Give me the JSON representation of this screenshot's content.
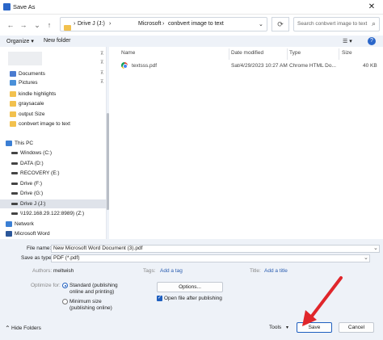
{
  "window": {
    "title": "Save As",
    "close": "✕"
  },
  "nav": {
    "back": "←",
    "forward": "→",
    "up": "↑"
  },
  "address": {
    "segments": [
      "›",
      "Drive J (J:)",
      "›",
      "Microsoft",
      "›",
      "conbvert image to text"
    ],
    "dropdown": "⌄"
  },
  "refresh": "⟳",
  "search": {
    "placeholder": "Search conbvert image to text",
    "icon": "⌕"
  },
  "toolbar": {
    "organize": "Organize ▾",
    "new_folder": "New folder",
    "view": "☰ ▾",
    "help": "?"
  },
  "sidebar": {
    "items": [
      {
        "label": "Documents",
        "icon": "documents-icon",
        "color": "#4a7bd0",
        "pinned": true
      },
      {
        "label": "Pictures",
        "icon": "pictures-icon",
        "color": "#4a90d9",
        "pinned": true
      },
      {
        "label": "kindle highlights",
        "icon": "folder-icon",
        "color": "#f2c14e",
        "pinned": false
      },
      {
        "label": "graysacale",
        "icon": "folder-icon",
        "color": "#f2c14e",
        "pinned": false
      },
      {
        "label": "output Size",
        "icon": "folder-icon",
        "color": "#f2c14e",
        "pinned": false
      },
      {
        "label": "conbvert image to text",
        "icon": "folder-icon",
        "color": "#f2c14e",
        "pinned": false
      },
      {
        "label": "This PC",
        "icon": "computer-icon",
        "color": "#3b7fd4",
        "pinned": false
      },
      {
        "label": "Windows (C:)",
        "icon": "drive-icon",
        "color": "#444444",
        "pinned": false
      },
      {
        "label": "DATA (D:)",
        "icon": "drive-icon",
        "color": "#444444",
        "pinned": false
      },
      {
        "label": "RECOVERY (E:)",
        "icon": "drive-icon",
        "color": "#444444",
        "pinned": false
      },
      {
        "label": "Drive (F:)",
        "icon": "drive-icon",
        "color": "#444444",
        "pinned": false
      },
      {
        "label": "Drive (G:)",
        "icon": "drive-icon",
        "color": "#444444",
        "pinned": false
      },
      {
        "label": "Drive J (J:)",
        "icon": "drive-icon",
        "color": "#444444",
        "pinned": false,
        "selected": true
      },
      {
        "label": "\\\\192.168.29.122:8989) (Z:)",
        "icon": "network-drive-icon",
        "color": "#444444",
        "pinned": false
      },
      {
        "label": "Network",
        "icon": "network-icon",
        "color": "#3b7fd4",
        "pinned": false
      },
      {
        "label": "Microsoft Word",
        "icon": "word-icon",
        "color": "#2b579a",
        "pinned": false
      }
    ]
  },
  "files": {
    "columns": {
      "name": "Name",
      "date": "Date modified",
      "type": "Type",
      "size": "Size"
    },
    "rows": [
      {
        "name": "textsss.pdf",
        "date": "Sat/4/29/2023 10:27 AM",
        "type": "Chrome HTML Do...",
        "size": "40 KB"
      }
    ]
  },
  "form": {
    "file_name_label": "File name:",
    "file_name_value": "New Microsoft Word Document (3).pdf",
    "save_type_label": "Save as type:",
    "save_type_value": "PDF (*.pdf)",
    "authors_label": "Authors:",
    "authors_value": "meltwish",
    "tags_label": "Tags:",
    "tags_value": "Add a tag",
    "title_label": "Title:",
    "title_value": "Add a title",
    "optimize_label": "Optimize for:",
    "opt_standard": "Standard (publishing online and printing)",
    "opt_minimum": "Minimum size (publishing online)",
    "options_button": "Options...",
    "open_after": "Open file after publishing",
    "check": "✓"
  },
  "footer": {
    "hide_folders": "Hide Folders",
    "tools": "Tools",
    "save": "Save",
    "cancel": "Cancel"
  },
  "accent": "#1f5fbf",
  "annotation_color": "#e0262b"
}
